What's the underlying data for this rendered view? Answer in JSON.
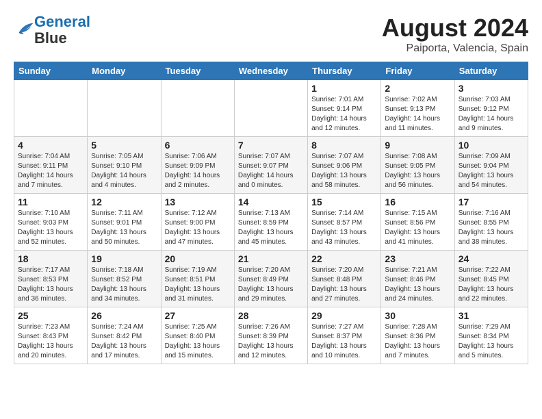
{
  "logo": {
    "line1": "General",
    "line2": "Blue"
  },
  "title": "August 2024",
  "subtitle": "Paiporta, Valencia, Spain",
  "weekdays": [
    "Sunday",
    "Monday",
    "Tuesday",
    "Wednesday",
    "Thursday",
    "Friday",
    "Saturday"
  ],
  "weeks": [
    [
      {
        "day": "",
        "info": ""
      },
      {
        "day": "",
        "info": ""
      },
      {
        "day": "",
        "info": ""
      },
      {
        "day": "",
        "info": ""
      },
      {
        "day": "1",
        "info": "Sunrise: 7:01 AM\nSunset: 9:14 PM\nDaylight: 14 hours\nand 12 minutes."
      },
      {
        "day": "2",
        "info": "Sunrise: 7:02 AM\nSunset: 9:13 PM\nDaylight: 14 hours\nand 11 minutes."
      },
      {
        "day": "3",
        "info": "Sunrise: 7:03 AM\nSunset: 9:12 PM\nDaylight: 14 hours\nand 9 minutes."
      }
    ],
    [
      {
        "day": "4",
        "info": "Sunrise: 7:04 AM\nSunset: 9:11 PM\nDaylight: 14 hours\nand 7 minutes."
      },
      {
        "day": "5",
        "info": "Sunrise: 7:05 AM\nSunset: 9:10 PM\nDaylight: 14 hours\nand 4 minutes."
      },
      {
        "day": "6",
        "info": "Sunrise: 7:06 AM\nSunset: 9:09 PM\nDaylight: 14 hours\nand 2 minutes."
      },
      {
        "day": "7",
        "info": "Sunrise: 7:07 AM\nSunset: 9:07 PM\nDaylight: 14 hours\nand 0 minutes."
      },
      {
        "day": "8",
        "info": "Sunrise: 7:07 AM\nSunset: 9:06 PM\nDaylight: 13 hours\nand 58 minutes."
      },
      {
        "day": "9",
        "info": "Sunrise: 7:08 AM\nSunset: 9:05 PM\nDaylight: 13 hours\nand 56 minutes."
      },
      {
        "day": "10",
        "info": "Sunrise: 7:09 AM\nSunset: 9:04 PM\nDaylight: 13 hours\nand 54 minutes."
      }
    ],
    [
      {
        "day": "11",
        "info": "Sunrise: 7:10 AM\nSunset: 9:03 PM\nDaylight: 13 hours\nand 52 minutes."
      },
      {
        "day": "12",
        "info": "Sunrise: 7:11 AM\nSunset: 9:01 PM\nDaylight: 13 hours\nand 50 minutes."
      },
      {
        "day": "13",
        "info": "Sunrise: 7:12 AM\nSunset: 9:00 PM\nDaylight: 13 hours\nand 47 minutes."
      },
      {
        "day": "14",
        "info": "Sunrise: 7:13 AM\nSunset: 8:59 PM\nDaylight: 13 hours\nand 45 minutes."
      },
      {
        "day": "15",
        "info": "Sunrise: 7:14 AM\nSunset: 8:57 PM\nDaylight: 13 hours\nand 43 minutes."
      },
      {
        "day": "16",
        "info": "Sunrise: 7:15 AM\nSunset: 8:56 PM\nDaylight: 13 hours\nand 41 minutes."
      },
      {
        "day": "17",
        "info": "Sunrise: 7:16 AM\nSunset: 8:55 PM\nDaylight: 13 hours\nand 38 minutes."
      }
    ],
    [
      {
        "day": "18",
        "info": "Sunrise: 7:17 AM\nSunset: 8:53 PM\nDaylight: 13 hours\nand 36 minutes."
      },
      {
        "day": "19",
        "info": "Sunrise: 7:18 AM\nSunset: 8:52 PM\nDaylight: 13 hours\nand 34 minutes."
      },
      {
        "day": "20",
        "info": "Sunrise: 7:19 AM\nSunset: 8:51 PM\nDaylight: 13 hours\nand 31 minutes."
      },
      {
        "day": "21",
        "info": "Sunrise: 7:20 AM\nSunset: 8:49 PM\nDaylight: 13 hours\nand 29 minutes."
      },
      {
        "day": "22",
        "info": "Sunrise: 7:20 AM\nSunset: 8:48 PM\nDaylight: 13 hours\nand 27 minutes."
      },
      {
        "day": "23",
        "info": "Sunrise: 7:21 AM\nSunset: 8:46 PM\nDaylight: 13 hours\nand 24 minutes."
      },
      {
        "day": "24",
        "info": "Sunrise: 7:22 AM\nSunset: 8:45 PM\nDaylight: 13 hours\nand 22 minutes."
      }
    ],
    [
      {
        "day": "25",
        "info": "Sunrise: 7:23 AM\nSunset: 8:43 PM\nDaylight: 13 hours\nand 20 minutes."
      },
      {
        "day": "26",
        "info": "Sunrise: 7:24 AM\nSunset: 8:42 PM\nDaylight: 13 hours\nand 17 minutes."
      },
      {
        "day": "27",
        "info": "Sunrise: 7:25 AM\nSunset: 8:40 PM\nDaylight: 13 hours\nand 15 minutes."
      },
      {
        "day": "28",
        "info": "Sunrise: 7:26 AM\nSunset: 8:39 PM\nDaylight: 13 hours\nand 12 minutes."
      },
      {
        "day": "29",
        "info": "Sunrise: 7:27 AM\nSunset: 8:37 PM\nDaylight: 13 hours\nand 10 minutes."
      },
      {
        "day": "30",
        "info": "Sunrise: 7:28 AM\nSunset: 8:36 PM\nDaylight: 13 hours\nand 7 minutes."
      },
      {
        "day": "31",
        "info": "Sunrise: 7:29 AM\nSunset: 8:34 PM\nDaylight: 13 hours\nand 5 minutes."
      }
    ]
  ]
}
